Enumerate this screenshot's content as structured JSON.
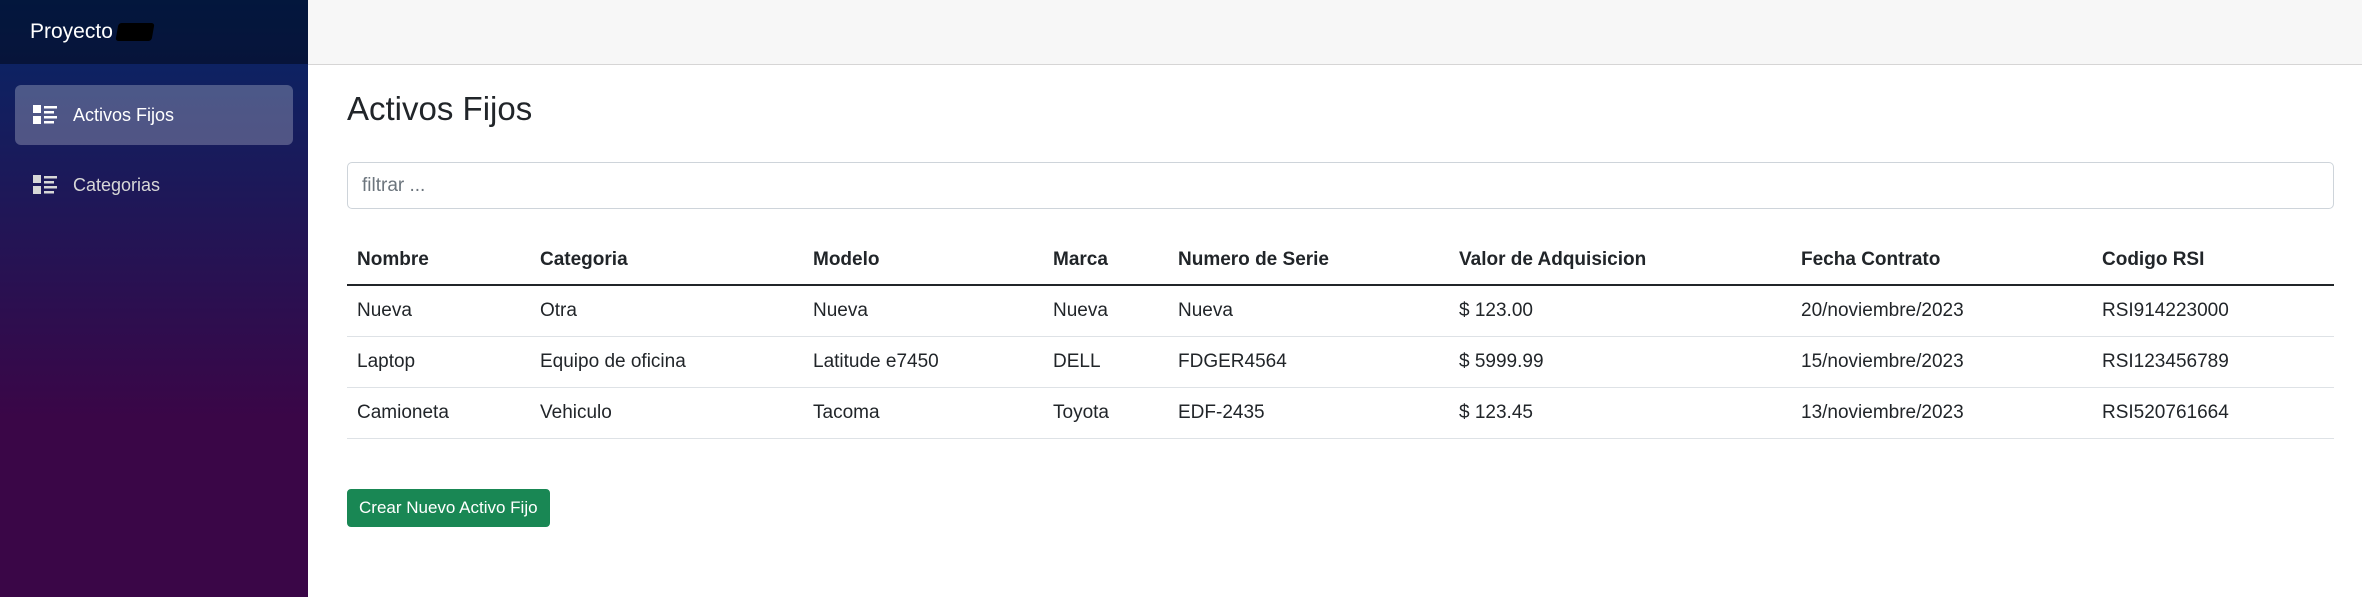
{
  "brand": {
    "name": "Proyecto"
  },
  "sidebar": {
    "items": [
      {
        "label": "Activos Fijos",
        "icon": "list-icon",
        "active": true
      },
      {
        "label": "Categorias",
        "icon": "list-icon",
        "active": false
      }
    ]
  },
  "main": {
    "title": "Activos Fijos",
    "filter": {
      "placeholder": "filtrar ...",
      "value": ""
    },
    "table": {
      "headers": [
        "Nombre",
        "Categoria",
        "Modelo",
        "Marca",
        "Numero de Serie",
        "Valor de Adquisicion",
        "Fecha Contrato",
        "Codigo RSI"
      ],
      "rows": [
        [
          "Nueva",
          "Otra",
          "Nueva",
          "Nueva",
          "Nueva",
          "$ 123.00",
          "20/noviembre/2023",
          "RSI914223000"
        ],
        [
          "Laptop",
          "Equipo de oficina",
          "Latitude e7450",
          "DELL",
          "FDGER4564",
          "$ 5999.99",
          "15/noviembre/2023",
          "RSI123456789"
        ],
        [
          "Camioneta",
          "Vehiculo",
          "Tacoma",
          "Toyota",
          "EDF-2435",
          "$ 123.45",
          "13/noviembre/2023",
          "RSI520761664"
        ]
      ]
    },
    "create_button": "Crear Nuevo Activo Fijo"
  },
  "colors": {
    "sidebar_top": "#052767",
    "sidebar_bottom": "#3a0647",
    "button_green": "#198754"
  }
}
